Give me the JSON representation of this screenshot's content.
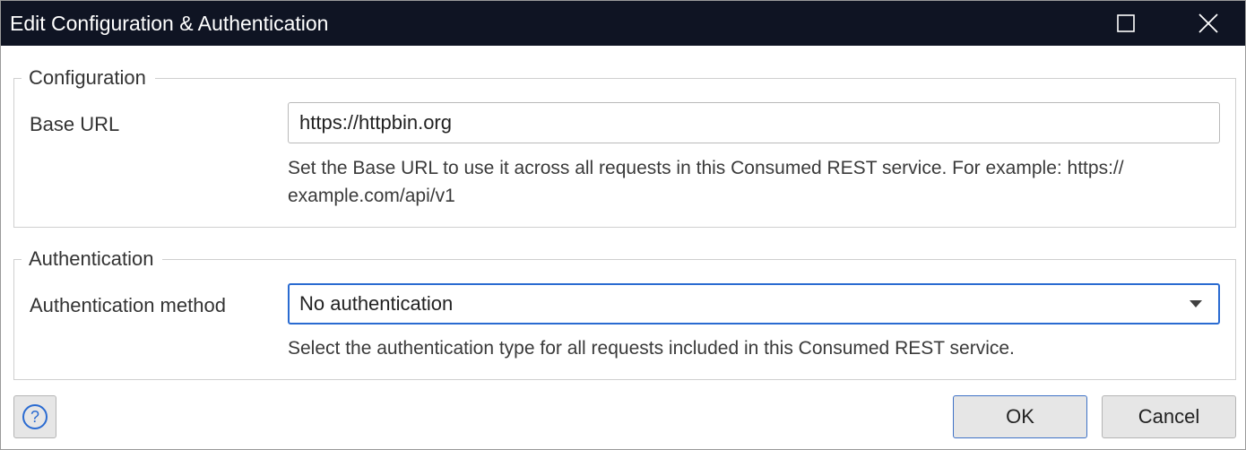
{
  "window": {
    "title": "Edit Configuration & Authentication"
  },
  "configuration": {
    "legend": "Configuration",
    "base_url_label": "Base URL",
    "base_url_value": "https://httpbin.org",
    "base_url_hint": "Set the Base URL to use it across all requests in this Consumed REST service. For example: https://​example.com/api/v1"
  },
  "authentication": {
    "legend": "Authentication",
    "method_label": "Authentication method",
    "method_selected": "No authentication",
    "method_hint": "Select the authentication type for all requests included in this Consumed REST service."
  },
  "footer": {
    "help_glyph": "?",
    "ok_label": "OK",
    "cancel_label": "Cancel"
  },
  "icons": {
    "maximize": "maximize-icon",
    "close": "close-icon",
    "help": "help-icon",
    "dropdown": "chevron-down-icon"
  },
  "colors": {
    "titlebar": "#0f1423",
    "accent": "#2a6bd1"
  }
}
